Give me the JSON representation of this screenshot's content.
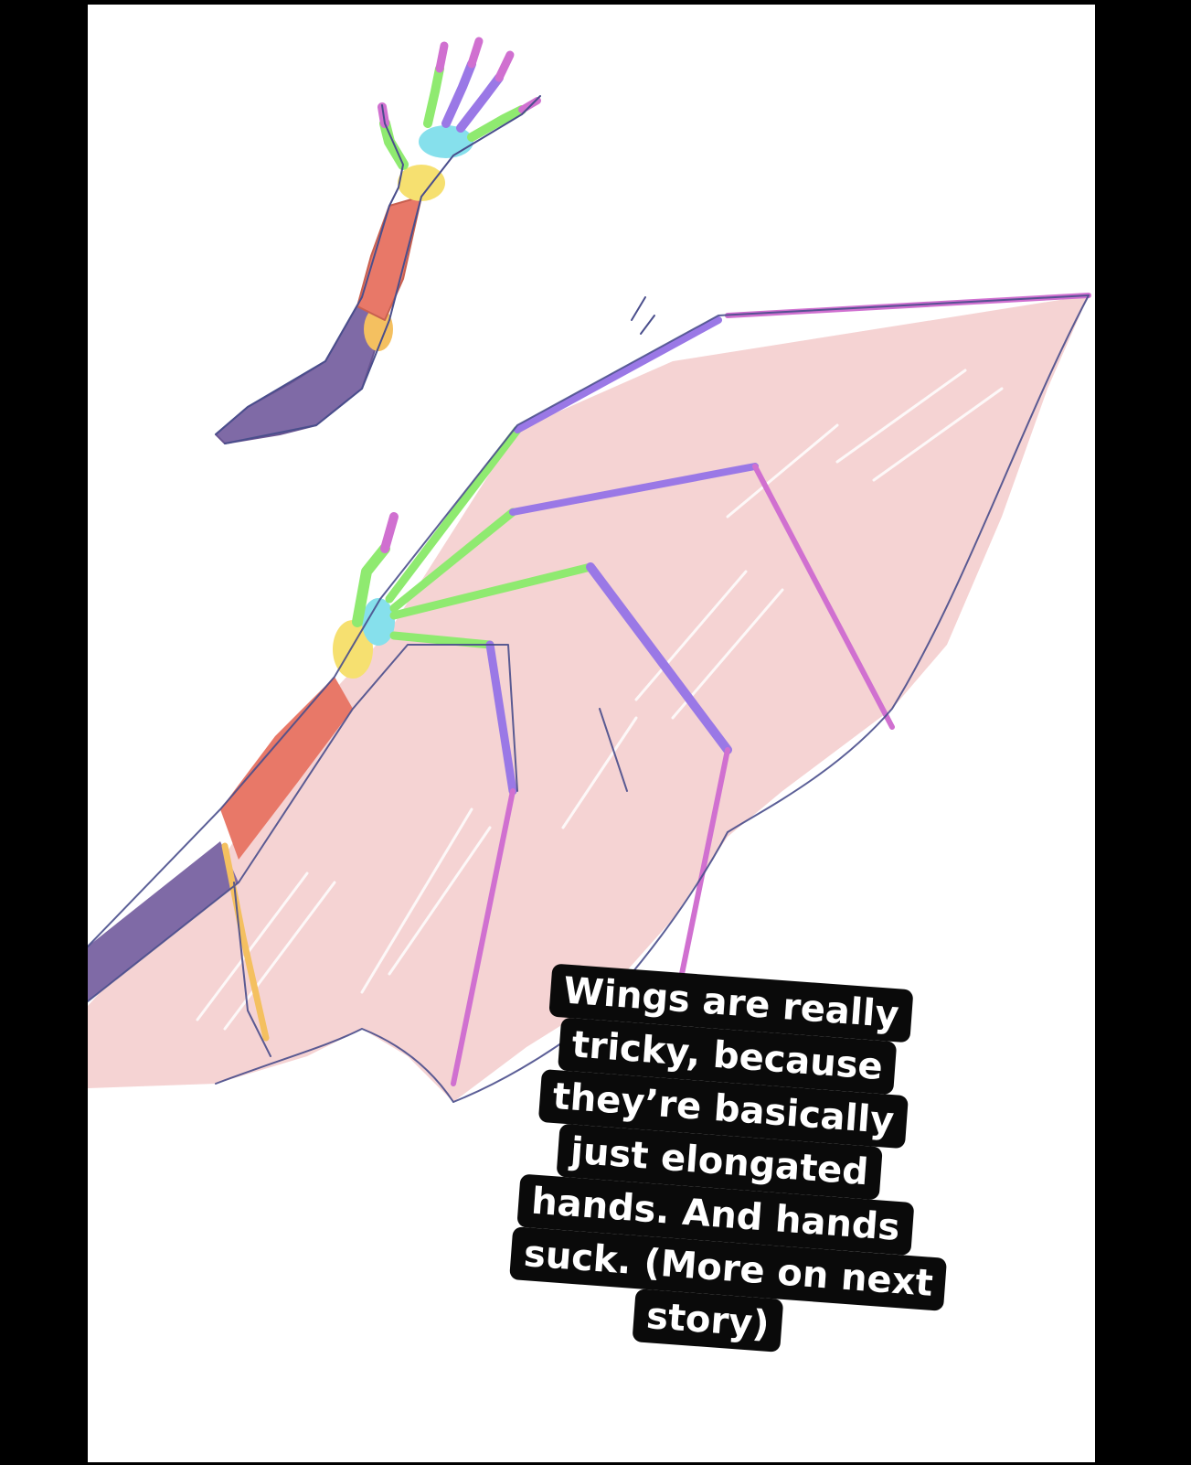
{
  "image": {
    "background_color": "#000000",
    "canvas_color": "#ffffff",
    "palette": {
      "membrane": "#f5d3d3",
      "forearm": "#e87868",
      "upper_arm": "#7f6aa6",
      "finger_tip": "#d070d0",
      "finger_mid": "#9a78e6",
      "finger_base": "#8fea70",
      "carpal": "#86e0ec",
      "wrist": "#f6e070",
      "elbow": "#f4c060",
      "outline": "#4a4e8c"
    },
    "subjects": [
      "human-arm-sketch",
      "bat-wing-sketch"
    ]
  },
  "caption": {
    "lines": [
      "Wings are really",
      "tricky,  because",
      "they’re basically",
      "just elongated",
      "hands. And hands",
      "suck. (More on next",
      "story)"
    ]
  }
}
